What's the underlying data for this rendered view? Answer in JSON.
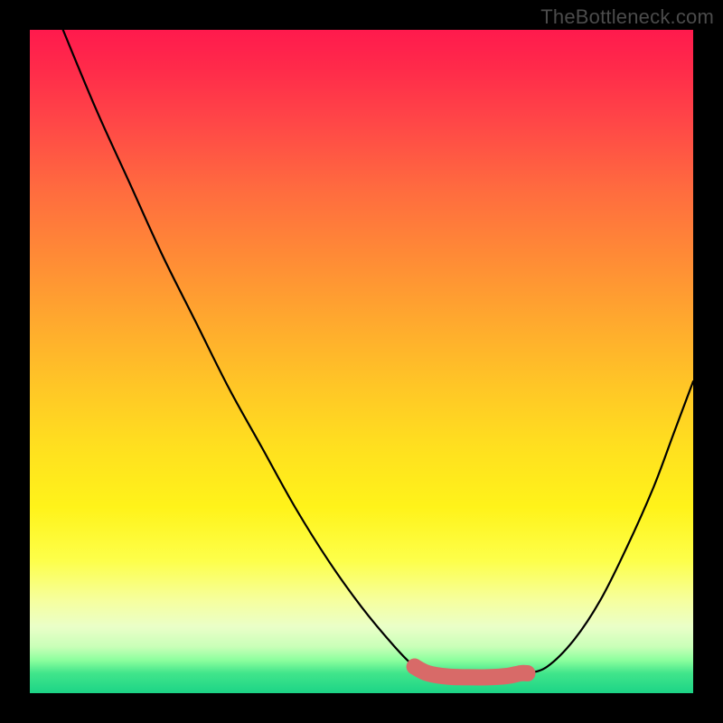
{
  "watermark": "TheBottleneck.com",
  "chart_data": {
    "type": "line",
    "title": "",
    "xlabel": "",
    "ylabel": "",
    "xlim": [
      0,
      100
    ],
    "ylim": [
      0,
      100
    ],
    "grid": false,
    "legend": false,
    "series": [
      {
        "name": "left-curve",
        "x": [
          5,
          10,
          15,
          20,
          25,
          30,
          35,
          40,
          45,
          50,
          55,
          58,
          60
        ],
        "values": [
          100,
          88,
          77,
          66,
          56,
          46,
          37,
          28,
          20,
          13,
          7,
          4,
          3
        ]
      },
      {
        "name": "right-curve",
        "x": [
          75,
          78,
          82,
          86,
          90,
          94,
          97,
          100
        ],
        "values": [
          3,
          4,
          8,
          14,
          22,
          31,
          39,
          47
        ]
      },
      {
        "name": "optimal-range",
        "x": [
          58,
          60,
          63,
          66,
          69,
          72,
          74,
          75
        ],
        "values": [
          4,
          3,
          2.5,
          2.4,
          2.4,
          2.6,
          3,
          3
        ]
      }
    ],
    "annotations": [
      {
        "name": "optimal-dot",
        "x": 58,
        "y": 4
      }
    ],
    "background_gradient": {
      "top": "#ff1a4d",
      "mid": "#ffe01f",
      "bottom": "#1cd486"
    },
    "highlight_color": "#d86a68"
  }
}
